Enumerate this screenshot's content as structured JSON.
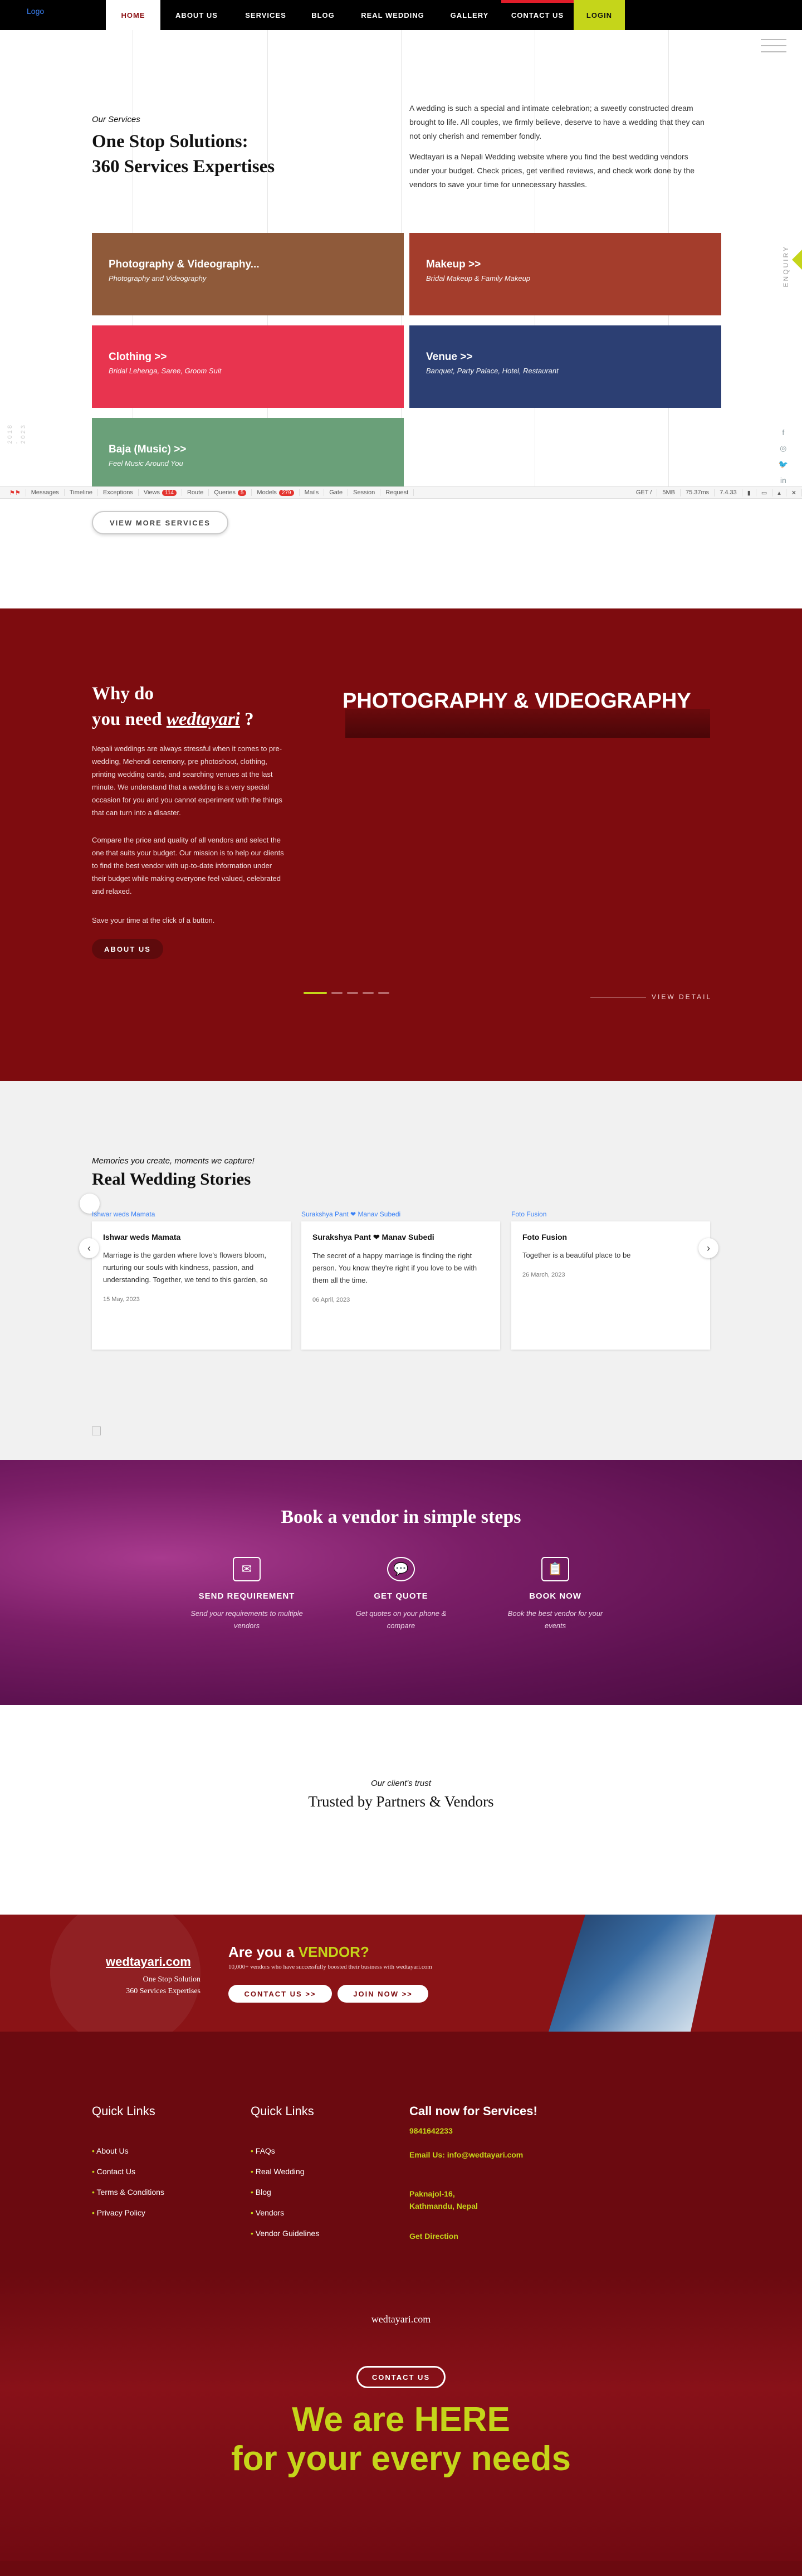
{
  "nav": {
    "logo_alt": "Logo",
    "items": [
      "HOME",
      "ABOUT US",
      "SERVICES",
      "BLOG",
      "REAL WEDDING",
      "GALLERY",
      "CONTACT US"
    ],
    "login": "LOGIN"
  },
  "services": {
    "kicker": "Our Services",
    "title_line1": "One Stop Solutions:",
    "title_line2": "360 Services Expertises",
    "intro1": "A wedding is such a special and intimate celebration; a sweetly constructed dream brought to life. All couples, we firmly believe, deserve to have a wedding that they can not only cherish and remember fondly.",
    "intro2": "Wedtayari is a Nepali Wedding website where you find the best wedding vendors under your budget. Check prices, get verified reviews, and check work done by the vendors to save your time for unnecessary hassles.",
    "cards": [
      {
        "title": "Photography & Videography...",
        "sub": "Photography and Videography",
        "color": "#8f5a3a"
      },
      {
        "title": "Makeup  >>",
        "sub": "Bridal Makeup & Family Makeup",
        "color": "#a43d2c"
      },
      {
        "title": "Clothing  >>",
        "sub": "Bridal Lehenga, Saree, Groom Suit",
        "color": "#e8344f"
      },
      {
        "title": "Venue  >>",
        "sub": "Banquet, Party Palace, Hotel, Restaurant",
        "color": "#2c3f73"
      },
      {
        "title": "Baja (Music)  >>",
        "sub": "Feel Music Around You",
        "color": "#6aa079"
      }
    ],
    "view_more": "VIEW MORE SERVICES",
    "enquiry": "ENQUIRY",
    "vertical_text": "2018 - 2023"
  },
  "social": {
    "icons": [
      "facebook-icon",
      "instagram-icon",
      "twitter-icon",
      "linkedin-icon"
    ],
    "glyphs": [
      "f",
      "◎",
      "🐦",
      "in"
    ]
  },
  "debugbar": {
    "items": [
      "Messages",
      "Timeline",
      "Exceptions",
      "Views",
      "Route",
      "Queries",
      "Models",
      "Mails",
      "Gate",
      "Session",
      "Request"
    ],
    "badges": {
      "Views": "114",
      "Queries": "5",
      "Models": "279"
    },
    "right": [
      "GET /",
      "5MB",
      "75.37ms",
      "7.4.33"
    ]
  },
  "why": {
    "title_a": "Why do",
    "title_b": "you need ",
    "brand": "wedtayari",
    "title_q": " ?",
    "p1": "Nepali weddings are always stressful when it comes to pre-wedding, Mehendi ceremony, pre photoshoot, clothing, printing wedding cards, and searching venues at the last minute. We understand that a wedding is a very special occasion for you and you cannot experiment with the things that can turn into a disaster.",
    "p2": "Compare the price and quality of all vendors and select the one that suits your budget. Our mission is to help our clients to find the best vendor with up-to-date information under their budget while making everyone feel valued, celebrated and relaxed.",
    "p3": "Save your time at the click of a button.",
    "about_btn": "ABOUT US",
    "slide_title": "PHOTOGRAPHY & VIDEOGRAPHY",
    "view_detail": "VIEW DETAIL",
    "active_slide": 1,
    "slide_count": 5
  },
  "stories": {
    "kicker": "Memories you create, moments we capture!",
    "title": "Real Wedding Stories",
    "items": [
      {
        "img_alt": "Ishwar weds Mamata",
        "name": "Ishwar weds Mamata",
        "excerpt": "Marriage is the garden where love's flowers bloom, nurturing our souls with kindness, passion, and understanding. Together, we tend to this garden, so",
        "date": "15 May, 2023"
      },
      {
        "img_alt": "Surakshya Pant ❤ Manav Subedi",
        "name": "Surakshya Pant ❤ Manav Subedi",
        "excerpt": "The secret of a happy marriage is finding the right person. You know they're right if you love to be with them all the time.",
        "date": "06 April, 2023"
      },
      {
        "img_alt": "Foto Fusion",
        "name": "Foto Fusion",
        "excerpt": "Together is a beautiful place to be",
        "date": "26 March, 2023"
      }
    ]
  },
  "book": {
    "title": "Book a vendor in simple steps",
    "steps": [
      {
        "title": "SEND REQUIREMENT",
        "desc": "Send your requirements to multiple vendors",
        "icon": "envelope-icon",
        "glyph": "✉"
      },
      {
        "title": "GET QUOTE",
        "desc": "Get quotes on your phone & compare",
        "icon": "quote-bubble-icon",
        "glyph": "💬"
      },
      {
        "title": "BOOK NOW",
        "desc": "Book the best vendor for your events",
        "icon": "booking-icon",
        "glyph": "📋"
      }
    ]
  },
  "trusted": {
    "kicker": "Our client's trust",
    "title": "Trusted by Partners & Vendors"
  },
  "vendor": {
    "site": "wedtayari.com",
    "tag1": "One Stop Solution",
    "tag2": "360 Services Expertises",
    "q_a": "Are you a ",
    "q_b": "VENDOR?",
    "sub": "10,000+ vendors who have successfully boosted their business with wedtayari.com",
    "contact": "CONTACT US >>",
    "join": "JOIN NOW >>"
  },
  "footer": {
    "quick1_title": "Quick Links",
    "quick1": [
      "About Us",
      "Contact Us",
      "Terms & Conditions",
      "Privacy Policy"
    ],
    "quick2_title": "Quick Links",
    "quick2": [
      "FAQs",
      "Real Wedding",
      "Blog",
      "Vendors",
      "Vendor Guidelines"
    ],
    "call_title": "Call now for Services!",
    "phone": "9841642233",
    "email": "Email Us: info@wedtayari.com",
    "addr1": "Paknajol-16,",
    "addr2": "Kathmandu, Nepal",
    "direction": "Get Direction",
    "site": "wedtayari.com",
    "contact": "CONTACT US",
    "here1": "We are HERE",
    "here2": "for your every needs"
  }
}
